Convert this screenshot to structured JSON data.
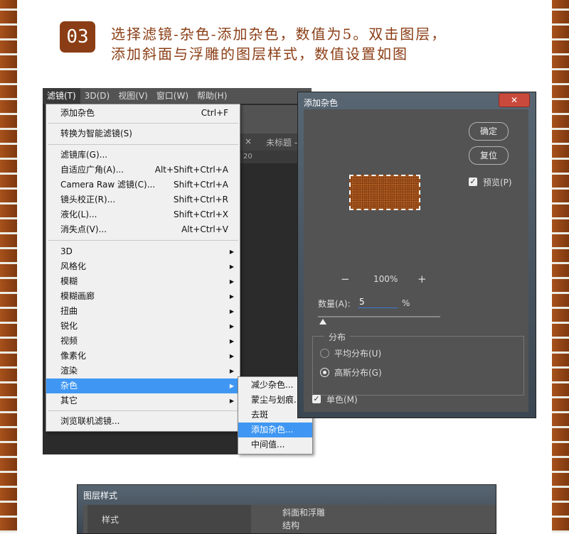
{
  "step": {
    "number": "03"
  },
  "instruction": {
    "line1": "选择滤镜-杂色-添加杂色，数值为5。双击图层，",
    "line2": "添加斜面与浮雕的图层样式，数值设置如图"
  },
  "menubar": [
    "滤镜(T)",
    "3D(D)",
    "视图(V)",
    "窗口(W)",
    "帮助(H)"
  ],
  "ps_tab": {
    "close": "×",
    "name": "未标题 -"
  },
  "ps_ruler": {
    "tick": "20"
  },
  "filter_menu": {
    "items": [
      {
        "label": "添加杂色",
        "shortcut": "Ctrl+F"
      },
      {
        "label": "转换为智能滤镜(S)",
        "shortcut": ""
      },
      {
        "label": "滤镜库(G)...",
        "shortcut": ""
      },
      {
        "label": "自适应广角(A)...",
        "shortcut": "Alt+Shift+Ctrl+A"
      },
      {
        "label": "Camera Raw 滤镜(C)...",
        "shortcut": "Shift+Ctrl+A"
      },
      {
        "label": "镜头校正(R)...",
        "shortcut": "Shift+Ctrl+R"
      },
      {
        "label": "液化(L)...",
        "shortcut": "Shift+Ctrl+X"
      },
      {
        "label": "消失点(V)...",
        "shortcut": "Alt+Ctrl+V"
      },
      {
        "label": "3D",
        "arrow": "▶"
      },
      {
        "label": "风格化",
        "arrow": "▶"
      },
      {
        "label": "模糊",
        "arrow": "▶"
      },
      {
        "label": "模糊画廊",
        "arrow": "▶"
      },
      {
        "label": "扭曲",
        "arrow": "▶"
      },
      {
        "label": "锐化",
        "arrow": "▶"
      },
      {
        "label": "视频",
        "arrow": "▶"
      },
      {
        "label": "像素化",
        "arrow": "▶"
      },
      {
        "label": "渲染",
        "arrow": "▶"
      },
      {
        "label": "杂色",
        "arrow": "▶"
      },
      {
        "label": "其它",
        "arrow": "▶"
      },
      {
        "label": "浏览联机滤镜..."
      }
    ]
  },
  "noise_submenu": [
    "减少杂色...",
    "蒙尘与划痕...",
    "去斑",
    "添加杂色...",
    "中间值..."
  ],
  "add_noise": {
    "title": "添加杂色",
    "close": "✕",
    "ok": "确定",
    "reset": "复位",
    "preview_label": "预览(P)",
    "zoom": "100%",
    "zoom_out": "−",
    "zoom_in": "+",
    "amount_label": "数量(A):",
    "amount_value": "5",
    "amount_unit": "%",
    "amount_slider_fraction": 0.05,
    "distribution_label": "分布",
    "uniform_label": "平均分布(U)",
    "gaussian_label": "高斯分布(G)",
    "mono_label": "单色(M)",
    "check_mark": "✓"
  },
  "layer_style": {
    "title": "图层样式",
    "styles_label": "样式",
    "section": "斜面和浮雕",
    "sub": "结构"
  }
}
